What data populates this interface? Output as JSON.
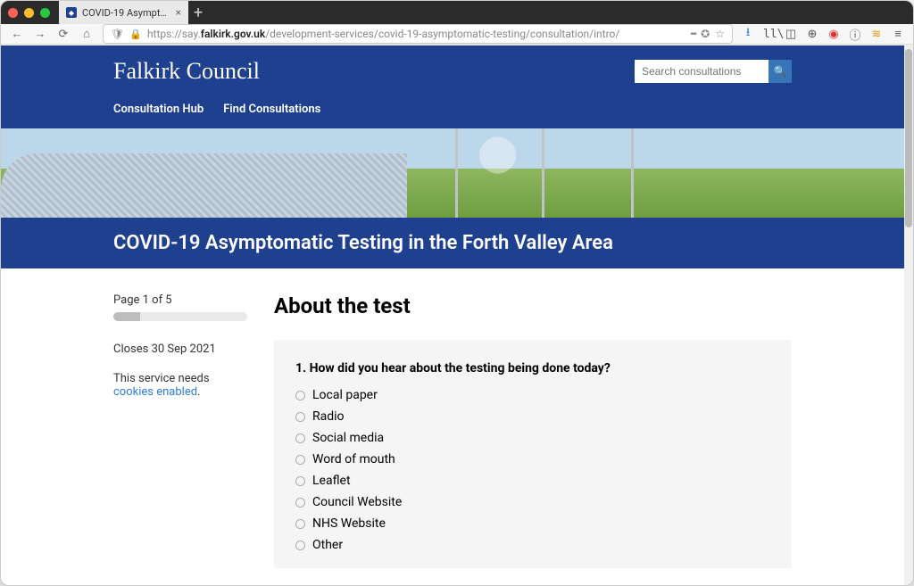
{
  "browser": {
    "tab_title": "COVID-19 Asymptomatic Testi...",
    "url_prefix": "https://say.",
    "url_bold": "falkirk.gov.uk",
    "url_suffix": "/development-services/covid-19-asymptomatic-testing/consultation/intro/"
  },
  "header": {
    "brand": "Falkirk Council",
    "search_placeholder": "Search consultations",
    "nav": [
      "Consultation Hub",
      "Find Consultations"
    ]
  },
  "page_title": "COVID-19 Asymptomatic Testing in the Forth Valley Area",
  "sidebar": {
    "page_label": "Page 1 of 5",
    "progress_pct": 20,
    "closes": "Closes 30 Sep 2021",
    "cookies_pre": "This service needs ",
    "cookies_link": "cookies enabled",
    "cookies_post": "."
  },
  "main": {
    "heading": "About the test",
    "question": "1. How did you hear about the testing being done today?",
    "options": [
      "Local paper",
      "Radio",
      "Social media",
      "Word of mouth",
      "Leaflet",
      "Council Website",
      "NHS Website",
      "Other"
    ]
  }
}
